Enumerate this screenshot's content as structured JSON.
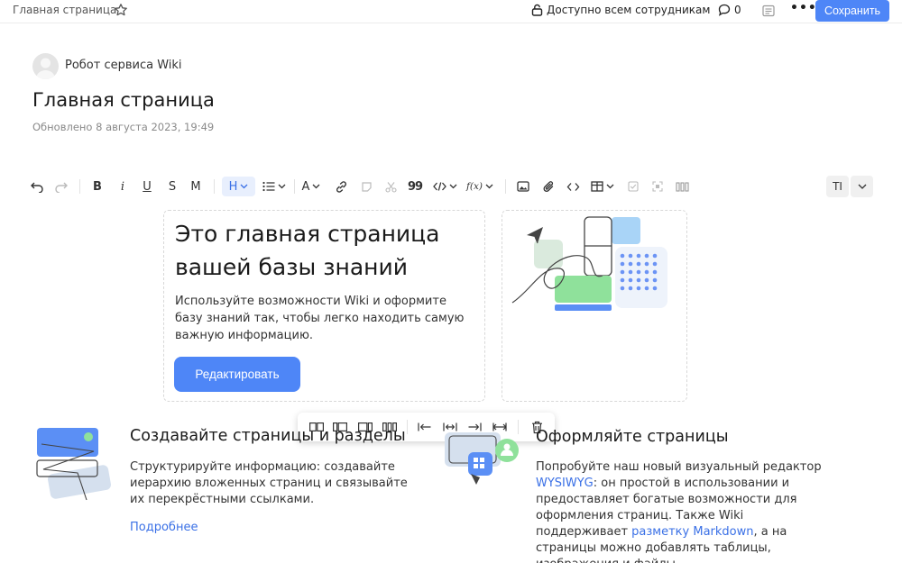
{
  "topbar": {
    "breadcrumb": "Главная страница",
    "access_label": "Доступно всем сотрудникам",
    "comments_count": "0",
    "more_label": "•••",
    "save_label": "Сохранить"
  },
  "page": {
    "author": "Робот сервиса Wiki",
    "title": "Главная страница",
    "updated": "Обновлено 8 августа 2023, 19:49"
  },
  "toolbar": {
    "bold": "B",
    "italic": "i",
    "underline": "U",
    "strike": "S",
    "mono": "M",
    "heading": "H",
    "text_color": "A",
    "quote": "99",
    "formula": "f(x)",
    "code_inline": "<>",
    "text_mode": "TI"
  },
  "hero": {
    "title": "Это главная страница вашей базы знаний",
    "text": "Используйте возможности Wiki и оформите базу знаний так, чтобы легко находить самую важную информацию.",
    "button": "Редактировать"
  },
  "features": [
    {
      "title": "Создавайте страницы и разделы",
      "text": "Структурируйте информацию: создавайте иерархию вложенных страниц и связывайте их перекрёстными ссылками.",
      "link": "Подробнее"
    },
    {
      "title": "Оформляйте страницы",
      "text_1": "Попробуйте наш новый визуальный редактор ",
      "link_1": "WYSIWYG",
      "text_2": ": он простой в использовании и предоставляет богатые возможности для оформления страниц. Также Wiki поддерживает ",
      "link_2": "разметку Markdown",
      "text_3": ", а на страницы можно добавлять таблицы, изображения и файлы."
    }
  ],
  "colors": {
    "accent": "#4e86f7",
    "link": "#3a70e6",
    "illustration_green": "#8fe19b",
    "illustration_blue": "#a9d4f7"
  }
}
